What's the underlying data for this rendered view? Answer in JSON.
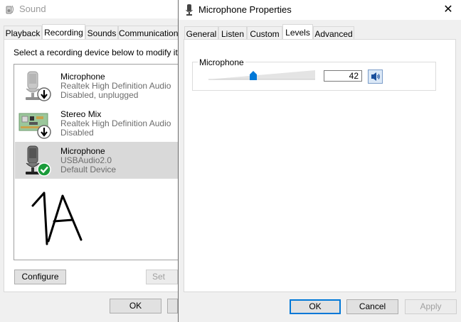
{
  "sound_window": {
    "title": "Sound",
    "tabs": [
      {
        "label": "Playback",
        "active": false
      },
      {
        "label": "Recording",
        "active": true
      },
      {
        "label": "Sounds",
        "active": false
      },
      {
        "label": "Communications",
        "active": false
      }
    ],
    "instruction": "Select a recording device below to modify its",
    "devices": [
      {
        "name": "Microphone",
        "description": "Realtek High Definition Audio",
        "status": "Disabled, unplugged",
        "icon": "microphone-disabled-icon",
        "selected": false
      },
      {
        "name": "Stereo Mix",
        "description": "Realtek High Definition Audio",
        "status": "Disabled",
        "icon": "circuit-board-disabled-icon",
        "selected": false
      },
      {
        "name": "Microphone",
        "description": "USBAudio2.0",
        "status": "Default Device",
        "icon": "microphone-default-icon",
        "selected": true
      }
    ],
    "handwritten_note": "1A",
    "buttons": {
      "configure": "Configure",
      "set_default": "Set Def",
      "ok": "OK"
    }
  },
  "props_window": {
    "title": "Microphone Properties",
    "tabs": [
      {
        "label": "General",
        "active": false
      },
      {
        "label": "Listen",
        "active": false
      },
      {
        "label": "Custom",
        "active": false
      },
      {
        "label": "Levels",
        "active": true
      },
      {
        "label": "Advanced",
        "active": false
      }
    ],
    "levels": {
      "label": "Microphone",
      "value": "42",
      "slider_fraction": 0.42
    },
    "buttons": {
      "ok": "OK",
      "cancel": "Cancel",
      "apply": "Apply"
    }
  },
  "colors": {
    "accent": "#0078d7",
    "selected_row": "#d9d9d9",
    "slider_thumb": "#0078d7",
    "check_green": "#1a9b3a"
  }
}
